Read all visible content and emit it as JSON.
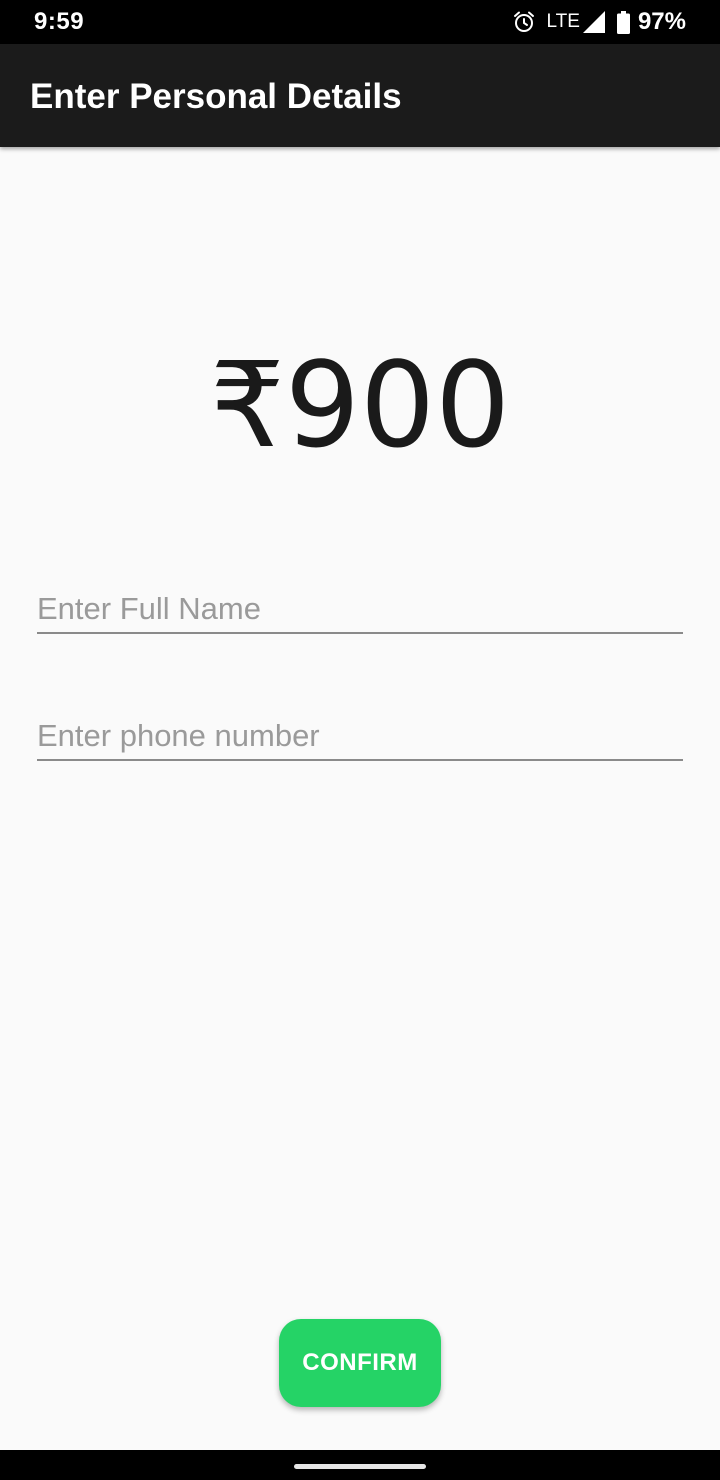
{
  "status_bar": {
    "time": "9:59",
    "network": "LTE",
    "battery": "97%",
    "icons": [
      "alarm-icon",
      "signal-icon",
      "battery-icon"
    ]
  },
  "app_bar": {
    "title": "Enter Personal Details",
    "background": "#1b1b1b"
  },
  "amount": "₹900",
  "form": {
    "name_placeholder": "Enter Full Name",
    "name_value": "",
    "phone_placeholder": "Enter phone number",
    "phone_value": ""
  },
  "confirm_button": {
    "label": "CONFIRM",
    "color": "#25d366"
  }
}
